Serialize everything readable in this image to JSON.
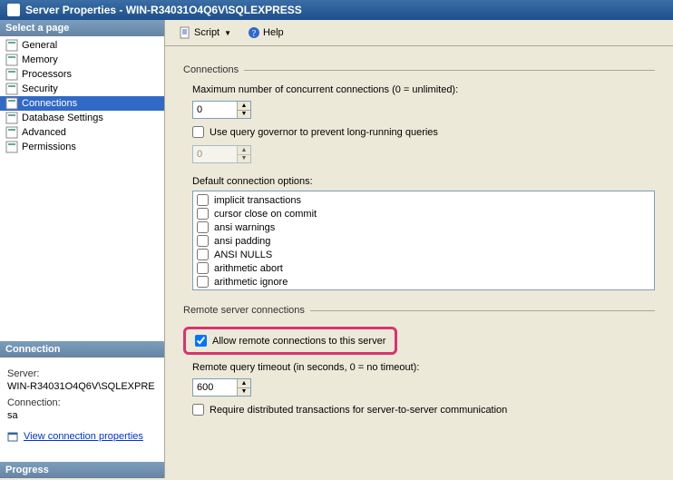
{
  "window": {
    "title": "Server Properties - WIN-R34031O4Q6V\\SQLEXPRESS"
  },
  "sidebar": {
    "header": "Select a page",
    "items": [
      {
        "label": "General"
      },
      {
        "label": "Memory"
      },
      {
        "label": "Processors"
      },
      {
        "label": "Security"
      },
      {
        "label": "Connections"
      },
      {
        "label": "Database Settings"
      },
      {
        "label": "Advanced"
      },
      {
        "label": "Permissions"
      }
    ]
  },
  "connection_panel": {
    "header": "Connection",
    "server_label": "Server:",
    "server_value": "WIN-R34031O4Q6V\\SQLEXPRE",
    "conn_label": "Connection:",
    "conn_value": "sa",
    "link": "View connection properties"
  },
  "progress": {
    "header": "Progress"
  },
  "toolbar": {
    "script": "Script",
    "help": "Help"
  },
  "content": {
    "group_connections": "Connections",
    "max_conn_label": "Maximum number of concurrent connections (0 = unlimited):",
    "max_conn_value": "0",
    "query_gov_label": "Use query governor to prevent long-running queries",
    "query_gov_value": "0",
    "default_opts_label": "Default connection options:",
    "opts": [
      {
        "label": "implicit transactions"
      },
      {
        "label": "cursor close on commit"
      },
      {
        "label": "ansi warnings"
      },
      {
        "label": "ansi padding"
      },
      {
        "label": "ANSI NULLS"
      },
      {
        "label": "arithmetic abort"
      },
      {
        "label": "arithmetic ignore"
      }
    ],
    "group_remote": "Remote server connections",
    "allow_remote_label": "Allow remote connections to this server",
    "remote_timeout_label": "Remote query timeout (in seconds, 0 = no timeout):",
    "remote_timeout_value": "600",
    "require_dist_label": "Require distributed transactions for server-to-server communication"
  }
}
